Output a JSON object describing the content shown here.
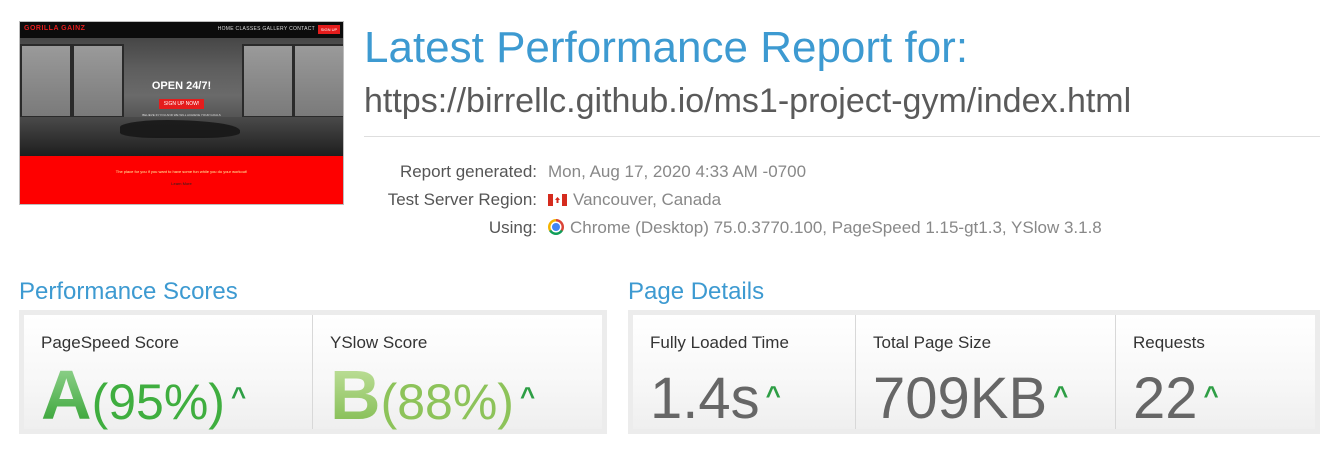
{
  "report": {
    "title": "Latest Performance Report for:",
    "url": "https://birrellc.github.io/ms1-project-gym/index.html"
  },
  "thumbnail": {
    "logo": "GORILLA GAINZ",
    "menu": "HOME CLASSES GALLERY CONTACT",
    "signup": "SIGN UP",
    "hero_title": "OPEN 24/7!",
    "hero_button": "SIGN UP NOW!",
    "hero_sub": "BELIEVE IN YOU AND WE WILL ACHIEVE YOUR GOALS",
    "red_line": "The place for you if you want to have some fun while you do your workout!",
    "red_link": "Learn More"
  },
  "meta": {
    "report_generated_label": "Report generated:",
    "report_generated_value": "Mon, Aug 17, 2020 4:33 AM -0700",
    "region_label": "Test Server Region:",
    "region_value": "Vancouver, Canada",
    "region_icon": "canada-flag-icon",
    "using_label": "Using:",
    "using_value": "Chrome (Desktop) 75.0.3770.100, PageSpeed 1.15-gt1.3, YSlow 3.1.8",
    "using_icon": "chrome-icon"
  },
  "performance": {
    "title": "Performance Scores",
    "pagespeed": {
      "label": "PageSpeed Score",
      "grade": "A",
      "percent": "(95%)",
      "trend_icon": "arrow-up-icon"
    },
    "yslow": {
      "label": "YSlow Score",
      "grade": "B",
      "percent": "(88%)",
      "trend_icon": "arrow-up-icon"
    }
  },
  "details": {
    "title": "Page Details",
    "load_time": {
      "label": "Fully Loaded Time",
      "value": "1.4s"
    },
    "page_size": {
      "label": "Total Page Size",
      "value": "709KB"
    },
    "requests": {
      "label": "Requests",
      "value": "22"
    }
  },
  "colors": {
    "accent": "#3d9ad1",
    "grade_a": "#3fae3f",
    "grade_b": "#8dc35a",
    "arrow": "#2e9e45"
  }
}
